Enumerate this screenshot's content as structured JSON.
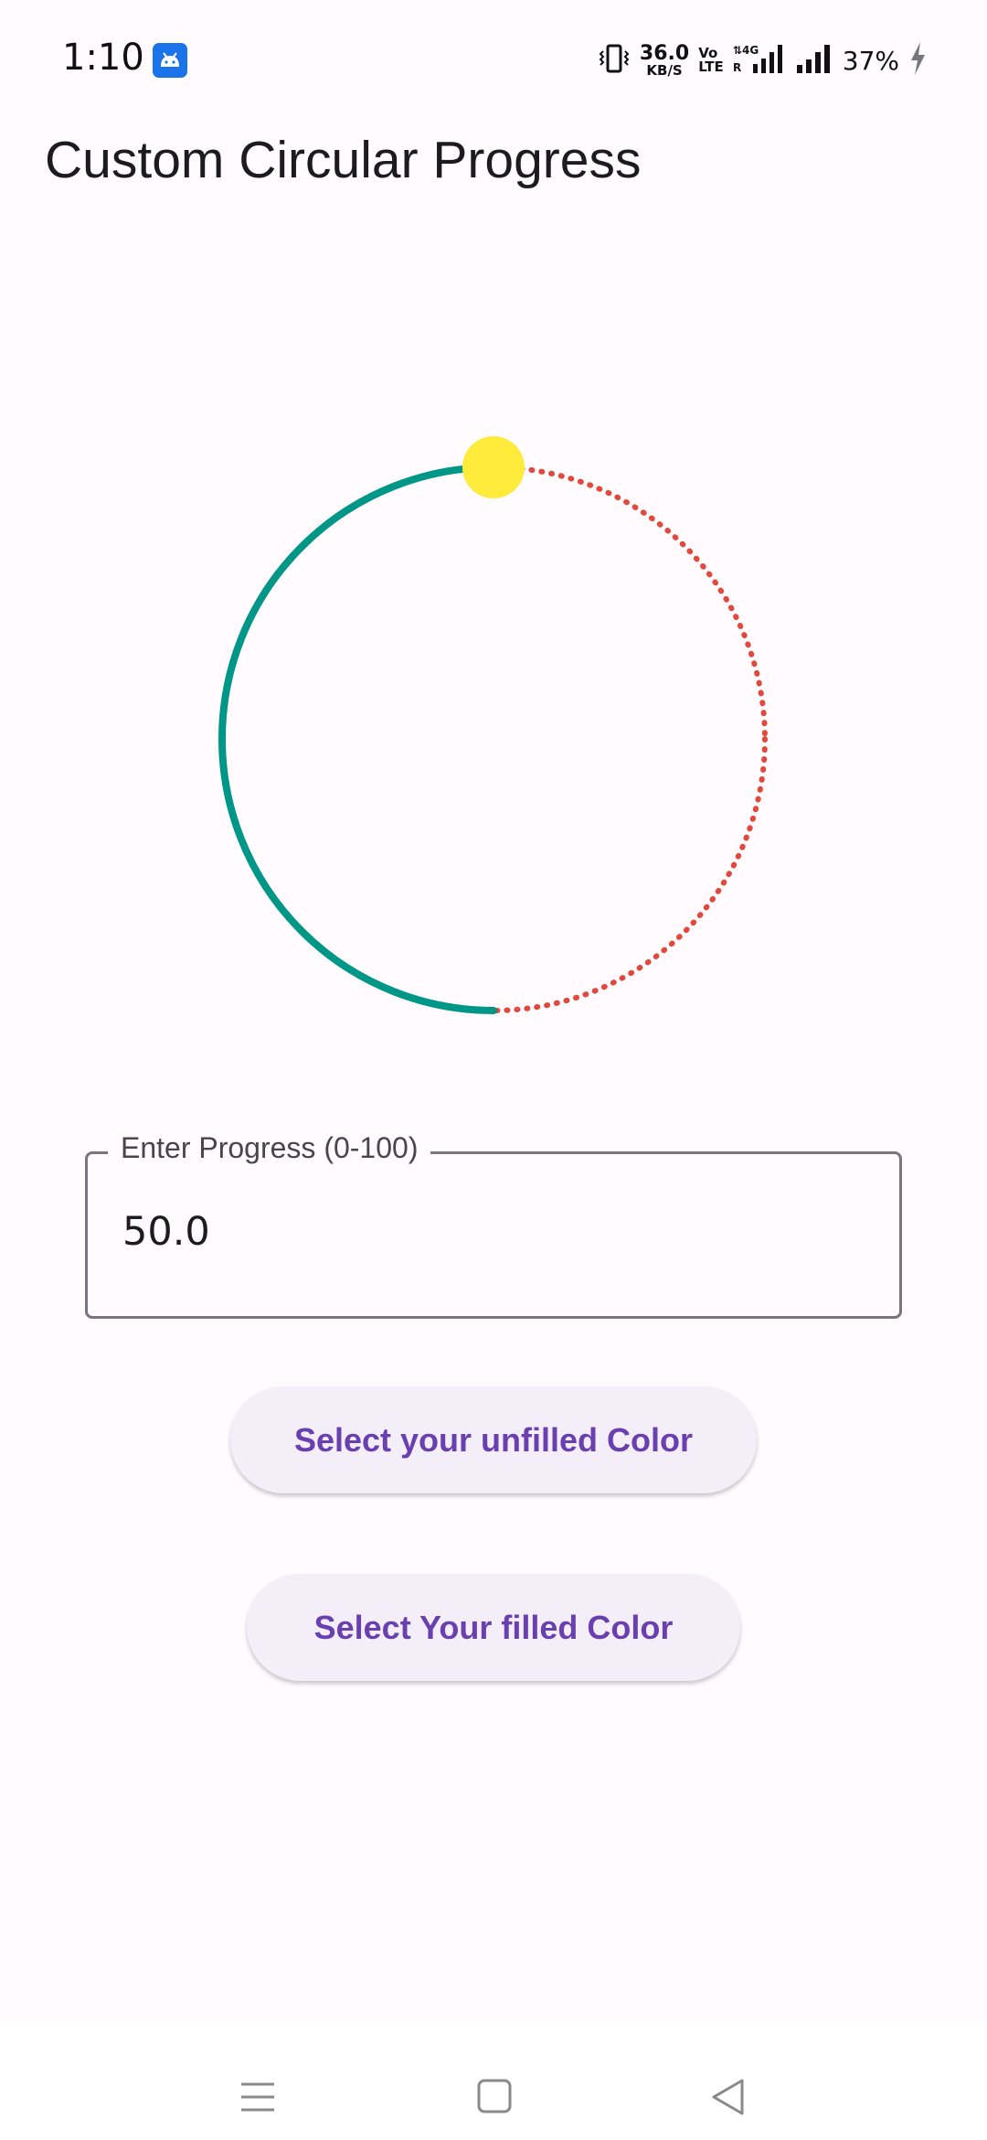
{
  "status_bar": {
    "time": "1:10",
    "app_icon": "android-icon",
    "net_speed_value": "36.0",
    "net_speed_unit": "KB/S",
    "volte_top": "Vo",
    "volte_bottom": "LTE",
    "battery_percent": "37%",
    "icons": [
      "vibrate-icon",
      "volte-icon",
      "4g-signal-icon",
      "signal-icon",
      "charging-icon"
    ]
  },
  "app_bar": {
    "title": "Custom Circular Progress"
  },
  "progress_ring": {
    "progress_percent": 50.0,
    "filled_color": "#009688",
    "unfilled_color": "#e0493b",
    "thumb_color": "#ffeb3b"
  },
  "progress_field": {
    "label": "Enter Progress (0-100)",
    "value": "50.0"
  },
  "buttons": {
    "unfilled_color_label": "Select your unfilled Color",
    "filled_color_label": "Select Your filled Color"
  },
  "nav_bar": {
    "icons": [
      "menu-icon",
      "home-icon",
      "back-icon"
    ]
  },
  "colors": {
    "background": "#fffbfe",
    "button_background": "#f4eef9",
    "button_text": "#6a3fb0",
    "field_border": "#79747e"
  }
}
